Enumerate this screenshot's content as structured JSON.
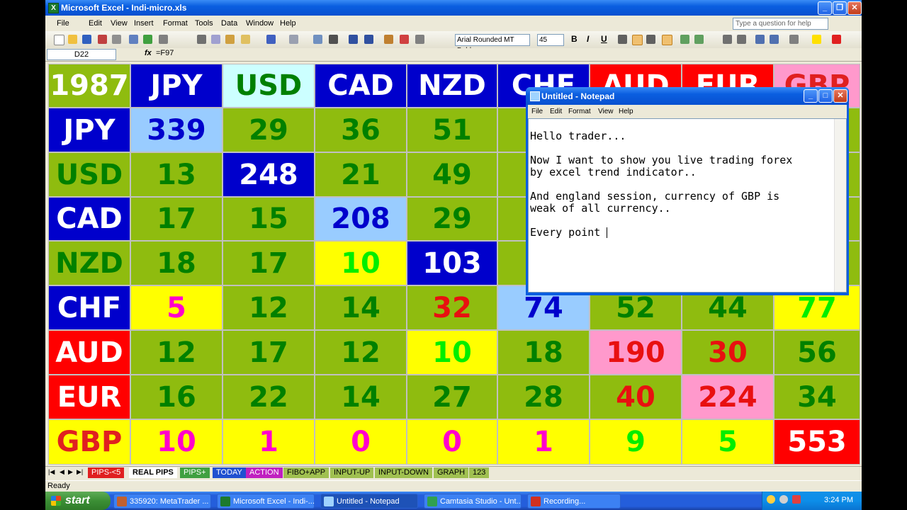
{
  "excel": {
    "title": "Microsoft Excel - Indi-micro.xls",
    "menu": [
      "File",
      "Edit",
      "View",
      "Insert",
      "Format",
      "Tools",
      "Data",
      "Window",
      "Help"
    ],
    "ask_placeholder": "Type a question for help",
    "font_name": "Arial Rounded MT Bold",
    "font_size": "45",
    "bold": "B",
    "italic": "I",
    "underline": "U",
    "name_box": "D22",
    "formula_fx": "fx",
    "formula": "=F97",
    "status": "Ready"
  },
  "grid": {
    "corner": "1987",
    "headers": [
      "JPY",
      "USD",
      "CAD",
      "NZD",
      "CHF",
      "AUD",
      "EUR",
      "GBP"
    ],
    "rows": [
      {
        "label": "JPY",
        "cells": [
          "339",
          "29",
          "36",
          "51",
          "",
          "",
          "",
          ""
        ]
      },
      {
        "label": "USD",
        "cells": [
          "13",
          "248",
          "21",
          "49",
          "",
          "",
          "",
          ""
        ]
      },
      {
        "label": "CAD",
        "cells": [
          "17",
          "15",
          "208",
          "29",
          "",
          "",
          "",
          ""
        ]
      },
      {
        "label": "NZD",
        "cells": [
          "18",
          "17",
          "10",
          "103",
          "",
          "",
          "",
          ""
        ]
      },
      {
        "label": "CHF",
        "cells": [
          "5",
          "12",
          "14",
          "32",
          "74",
          "52",
          "44",
          "77"
        ]
      },
      {
        "label": "AUD",
        "cells": [
          "12",
          "17",
          "12",
          "10",
          "18",
          "190",
          "30",
          "56"
        ]
      },
      {
        "label": "EUR",
        "cells": [
          "16",
          "22",
          "14",
          "27",
          "28",
          "40",
          "224",
          "34"
        ]
      },
      {
        "label": "GBP",
        "cells": [
          "10",
          "1",
          "0",
          "0",
          "1",
          "9",
          "5",
          "553"
        ]
      }
    ]
  },
  "sheet_tabs": [
    "PIPS-<5",
    "REAL PIPS",
    "PIPS+",
    "TODAY",
    "ACTION",
    "FIBO+APP",
    "INPUT-UP",
    "INPUT-DOWN",
    "GRAPH",
    "123"
  ],
  "notepad": {
    "title": "Untitled - Notepad",
    "menu": [
      "File",
      "Edit",
      "Format",
      "View",
      "Help"
    ],
    "lines": [
      "Hello trader...",
      "Now I want to show you live trading forex\nby excel trend indicator..",
      "And england session, currency of GBP is\nweak of all currency..",
      "Every point "
    ]
  },
  "taskbar": {
    "start": "start",
    "tasks": [
      "335920: MetaTrader ...",
      "Microsoft Excel - Indi-...",
      "Untitled - Notepad",
      "Camtasia Studio - Unt...",
      "Recording..."
    ],
    "clock": "3:24 PM"
  },
  "colors": {
    "olive": "#8fbc0f",
    "blue": "#0000cc",
    "lightblue": "#99ccff",
    "yellow": "#ffff00",
    "pink": "#ff99cc",
    "red": "#ff0000",
    "cyan": "#ccffff"
  }
}
